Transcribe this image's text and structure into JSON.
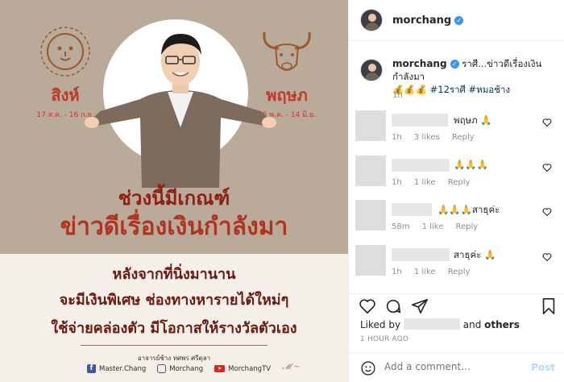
{
  "post": {
    "username": "morchang",
    "verified_icon": "verified-badge-icon",
    "image": {
      "sign_left": {
        "name": "สิงห์",
        "dates": "17 ส.ค. - 16 ก.ย."
      },
      "sign_right": {
        "name": "พฤษภ",
        "dates": "15 พ.ค. - 14 มิ.ย."
      },
      "headline_1": "ช่วงนี้มีเกณฑ์",
      "headline_2": "ข่าวดีเรื่องเงินกำลังมา",
      "body": [
        "หลังจากที่นิ่งมานาน",
        "จะมีเงินพิเศษ ช่องทางหารายได้ใหม่ๆ",
        "ใช้จ่ายคล่องตัว มีโอกาสให้รางวัลตัวเอง"
      ],
      "credit": "อาจารย์ช้าง ทศพร ศรีตุลา",
      "socials": {
        "facebook": "Master.Chang",
        "instagram": "Morchang",
        "youtube": "MorchangTV"
      }
    },
    "caption": {
      "username": "morchang",
      "text": " ราศี...ข่าวดีเรื่องเงินกำลังมา",
      "emojis": "💰💰💰",
      "hashtags": "#12ราศี #หมอช้าง",
      "time": "1h"
    },
    "comments": [
      {
        "text": "พฤษภ 🙏",
        "time": "1h",
        "likes": "3 likes",
        "reply": "Reply"
      },
      {
        "text": "🙏🙏🙏",
        "time": "1h",
        "likes": "1 like",
        "reply": "Reply"
      },
      {
        "text": "🙏🙏🙏สาธุค่ะ",
        "time": "58m",
        "likes": "1 like",
        "reply": "Reply"
      },
      {
        "text": "สาธุค่ะ 🙏",
        "time": "1h",
        "likes": "1 like",
        "reply": "Reply"
      }
    ],
    "likes": {
      "prefix": "Liked by",
      "suffix": "and",
      "others": "others"
    },
    "time_ago": "1 HOUR AGO",
    "add_comment": {
      "placeholder": "Add a comment...",
      "post_label": "Post"
    }
  },
  "colors": {
    "accent_blue": "#3897f0",
    "hashtag": "#00376b",
    "sign_red": "#c0392b",
    "headline_red": "#b0341f"
  }
}
